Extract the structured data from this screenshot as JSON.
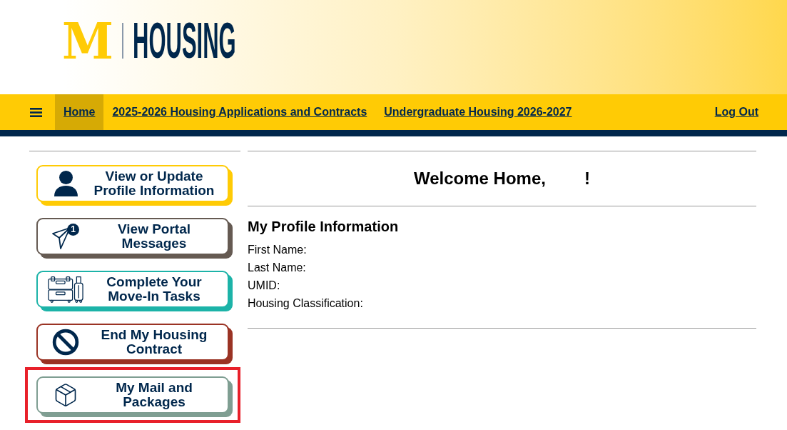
{
  "header": {
    "logo_mark": "M",
    "logo_text": "HOUSING"
  },
  "nav": {
    "items": [
      {
        "label": "Home",
        "selected": true
      },
      {
        "label": "2025-2026 Housing Applications and Contracts",
        "selected": false
      },
      {
        "label": "Undergraduate Housing 2026-2027",
        "selected": false
      }
    ],
    "logout": "Log Out"
  },
  "sidebar": {
    "buttons": [
      {
        "label_lines": [
          "View or Update",
          "Profile Information"
        ],
        "color": "#ffcb05",
        "highlighted": false
      },
      {
        "label_lines": [
          "View Portal",
          "Messages"
        ],
        "color": "#655a52",
        "badge": "1",
        "highlighted": false
      },
      {
        "label_lines": [
          "Complete Your",
          "Move-In Tasks"
        ],
        "color": "#1cb3a8",
        "highlighted": false
      },
      {
        "label_lines": [
          "End My Housing",
          "Contract"
        ],
        "color": "#9a3324",
        "highlighted": false
      },
      {
        "label_lines": [
          "My Mail and",
          "Packages"
        ],
        "color": "#7f9e92",
        "highlighted": true
      }
    ]
  },
  "main": {
    "welcome": [
      "Welcome Home,",
      "!"
    ],
    "profile": {
      "title": "My Profile Information",
      "fields": [
        "First Name:",
        "Last Name:",
        "UMID:",
        "Housing Classification:"
      ]
    }
  }
}
